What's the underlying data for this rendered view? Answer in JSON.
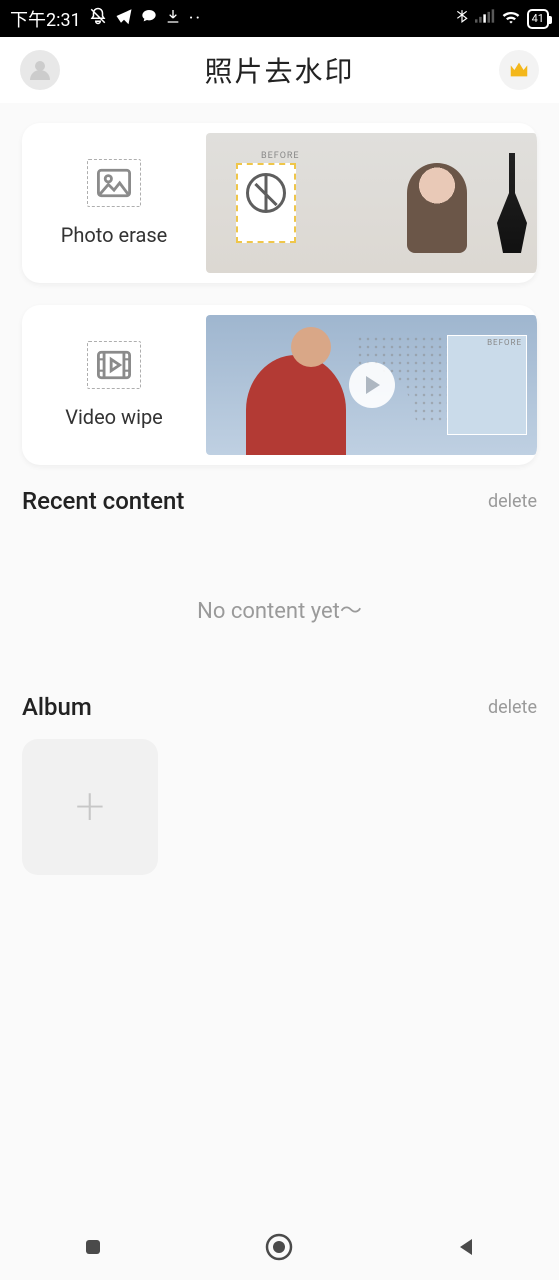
{
  "status": {
    "time": "下午2:31",
    "battery": "41"
  },
  "header": {
    "title": "照片去水印"
  },
  "cards": {
    "photo": {
      "label": "Photo erase",
      "before_tag": "BEFORE"
    },
    "video": {
      "label": "Video wipe",
      "before_tag": "BEFORE"
    }
  },
  "sections": {
    "recent": {
      "title": "Recent content",
      "action": "delete",
      "empty": "No content yet～"
    },
    "album": {
      "title": "Album",
      "action": "delete"
    }
  }
}
